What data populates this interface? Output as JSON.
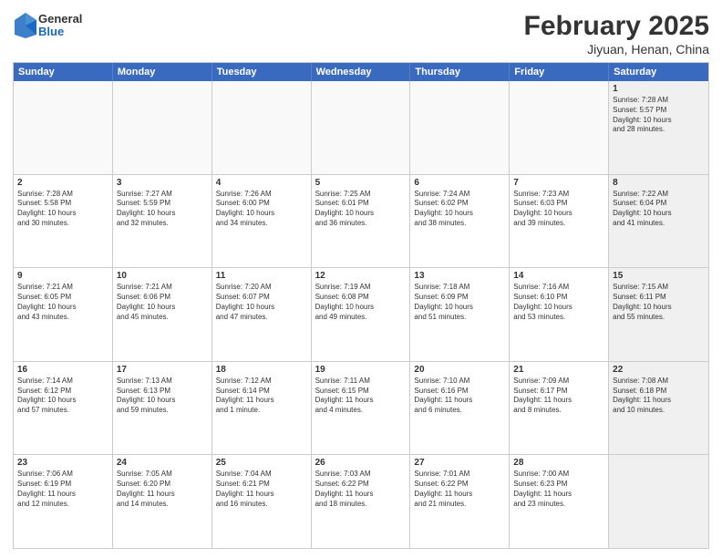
{
  "header": {
    "logo": {
      "general": "General",
      "blue": "Blue"
    },
    "month": "February 2025",
    "location": "Jiyuan, Henan, China"
  },
  "days_of_week": [
    "Sunday",
    "Monday",
    "Tuesday",
    "Wednesday",
    "Thursday",
    "Friday",
    "Saturday"
  ],
  "weeks": [
    [
      {
        "day": "",
        "info": "",
        "empty": true
      },
      {
        "day": "",
        "info": "",
        "empty": true
      },
      {
        "day": "",
        "info": "",
        "empty": true
      },
      {
        "day": "",
        "info": "",
        "empty": true
      },
      {
        "day": "",
        "info": "",
        "empty": true
      },
      {
        "day": "",
        "info": "",
        "empty": true
      },
      {
        "day": "1",
        "info": "Sunrise: 7:28 AM\nSunset: 5:57 PM\nDaylight: 10 hours\nand 28 minutes.",
        "empty": false,
        "shaded": true
      }
    ],
    [
      {
        "day": "2",
        "info": "Sunrise: 7:28 AM\nSunset: 5:58 PM\nDaylight: 10 hours\nand 30 minutes.",
        "empty": false,
        "shaded": false
      },
      {
        "day": "3",
        "info": "Sunrise: 7:27 AM\nSunset: 5:59 PM\nDaylight: 10 hours\nand 32 minutes.",
        "empty": false,
        "shaded": false
      },
      {
        "day": "4",
        "info": "Sunrise: 7:26 AM\nSunset: 6:00 PM\nDaylight: 10 hours\nand 34 minutes.",
        "empty": false,
        "shaded": false
      },
      {
        "day": "5",
        "info": "Sunrise: 7:25 AM\nSunset: 6:01 PM\nDaylight: 10 hours\nand 36 minutes.",
        "empty": false,
        "shaded": false
      },
      {
        "day": "6",
        "info": "Sunrise: 7:24 AM\nSunset: 6:02 PM\nDaylight: 10 hours\nand 38 minutes.",
        "empty": false,
        "shaded": false
      },
      {
        "day": "7",
        "info": "Sunrise: 7:23 AM\nSunset: 6:03 PM\nDaylight: 10 hours\nand 39 minutes.",
        "empty": false,
        "shaded": false
      },
      {
        "day": "8",
        "info": "Sunrise: 7:22 AM\nSunset: 6:04 PM\nDaylight: 10 hours\nand 41 minutes.",
        "empty": false,
        "shaded": true
      }
    ],
    [
      {
        "day": "9",
        "info": "Sunrise: 7:21 AM\nSunset: 6:05 PM\nDaylight: 10 hours\nand 43 minutes.",
        "empty": false,
        "shaded": false
      },
      {
        "day": "10",
        "info": "Sunrise: 7:21 AM\nSunset: 6:06 PM\nDaylight: 10 hours\nand 45 minutes.",
        "empty": false,
        "shaded": false
      },
      {
        "day": "11",
        "info": "Sunrise: 7:20 AM\nSunset: 6:07 PM\nDaylight: 10 hours\nand 47 minutes.",
        "empty": false,
        "shaded": false
      },
      {
        "day": "12",
        "info": "Sunrise: 7:19 AM\nSunset: 6:08 PM\nDaylight: 10 hours\nand 49 minutes.",
        "empty": false,
        "shaded": false
      },
      {
        "day": "13",
        "info": "Sunrise: 7:18 AM\nSunset: 6:09 PM\nDaylight: 10 hours\nand 51 minutes.",
        "empty": false,
        "shaded": false
      },
      {
        "day": "14",
        "info": "Sunrise: 7:16 AM\nSunset: 6:10 PM\nDaylight: 10 hours\nand 53 minutes.",
        "empty": false,
        "shaded": false
      },
      {
        "day": "15",
        "info": "Sunrise: 7:15 AM\nSunset: 6:11 PM\nDaylight: 10 hours\nand 55 minutes.",
        "empty": false,
        "shaded": true
      }
    ],
    [
      {
        "day": "16",
        "info": "Sunrise: 7:14 AM\nSunset: 6:12 PM\nDaylight: 10 hours\nand 57 minutes.",
        "empty": false,
        "shaded": false
      },
      {
        "day": "17",
        "info": "Sunrise: 7:13 AM\nSunset: 6:13 PM\nDaylight: 10 hours\nand 59 minutes.",
        "empty": false,
        "shaded": false
      },
      {
        "day": "18",
        "info": "Sunrise: 7:12 AM\nSunset: 6:14 PM\nDaylight: 11 hours\nand 1 minute.",
        "empty": false,
        "shaded": false
      },
      {
        "day": "19",
        "info": "Sunrise: 7:11 AM\nSunset: 6:15 PM\nDaylight: 11 hours\nand 4 minutes.",
        "empty": false,
        "shaded": false
      },
      {
        "day": "20",
        "info": "Sunrise: 7:10 AM\nSunset: 6:16 PM\nDaylight: 11 hours\nand 6 minutes.",
        "empty": false,
        "shaded": false
      },
      {
        "day": "21",
        "info": "Sunrise: 7:09 AM\nSunset: 6:17 PM\nDaylight: 11 hours\nand 8 minutes.",
        "empty": false,
        "shaded": false
      },
      {
        "day": "22",
        "info": "Sunrise: 7:08 AM\nSunset: 6:18 PM\nDaylight: 11 hours\nand 10 minutes.",
        "empty": false,
        "shaded": true
      }
    ],
    [
      {
        "day": "23",
        "info": "Sunrise: 7:06 AM\nSunset: 6:19 PM\nDaylight: 11 hours\nand 12 minutes.",
        "empty": false,
        "shaded": false
      },
      {
        "day": "24",
        "info": "Sunrise: 7:05 AM\nSunset: 6:20 PM\nDaylight: 11 hours\nand 14 minutes.",
        "empty": false,
        "shaded": false
      },
      {
        "day": "25",
        "info": "Sunrise: 7:04 AM\nSunset: 6:21 PM\nDaylight: 11 hours\nand 16 minutes.",
        "empty": false,
        "shaded": false
      },
      {
        "day": "26",
        "info": "Sunrise: 7:03 AM\nSunset: 6:22 PM\nDaylight: 11 hours\nand 18 minutes.",
        "empty": false,
        "shaded": false
      },
      {
        "day": "27",
        "info": "Sunrise: 7:01 AM\nSunset: 6:22 PM\nDaylight: 11 hours\nand 21 minutes.",
        "empty": false,
        "shaded": false
      },
      {
        "day": "28",
        "info": "Sunrise: 7:00 AM\nSunset: 6:23 PM\nDaylight: 11 hours\nand 23 minutes.",
        "empty": false,
        "shaded": false
      },
      {
        "day": "",
        "info": "",
        "empty": true,
        "shaded": true
      }
    ]
  ]
}
